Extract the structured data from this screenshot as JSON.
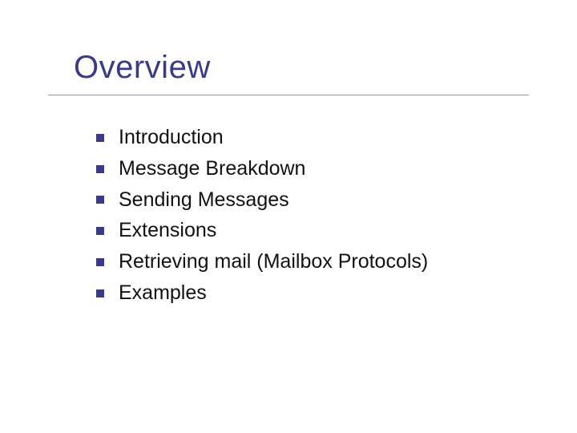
{
  "title": "Overview",
  "colors": {
    "accent": "#3a3a8a",
    "text": "#111111",
    "rule": "#999999"
  },
  "items": [
    "Introduction",
    "Message Breakdown",
    "Sending Messages",
    "Extensions",
    "Retrieving mail (Mailbox Protocols)",
    "Examples"
  ]
}
